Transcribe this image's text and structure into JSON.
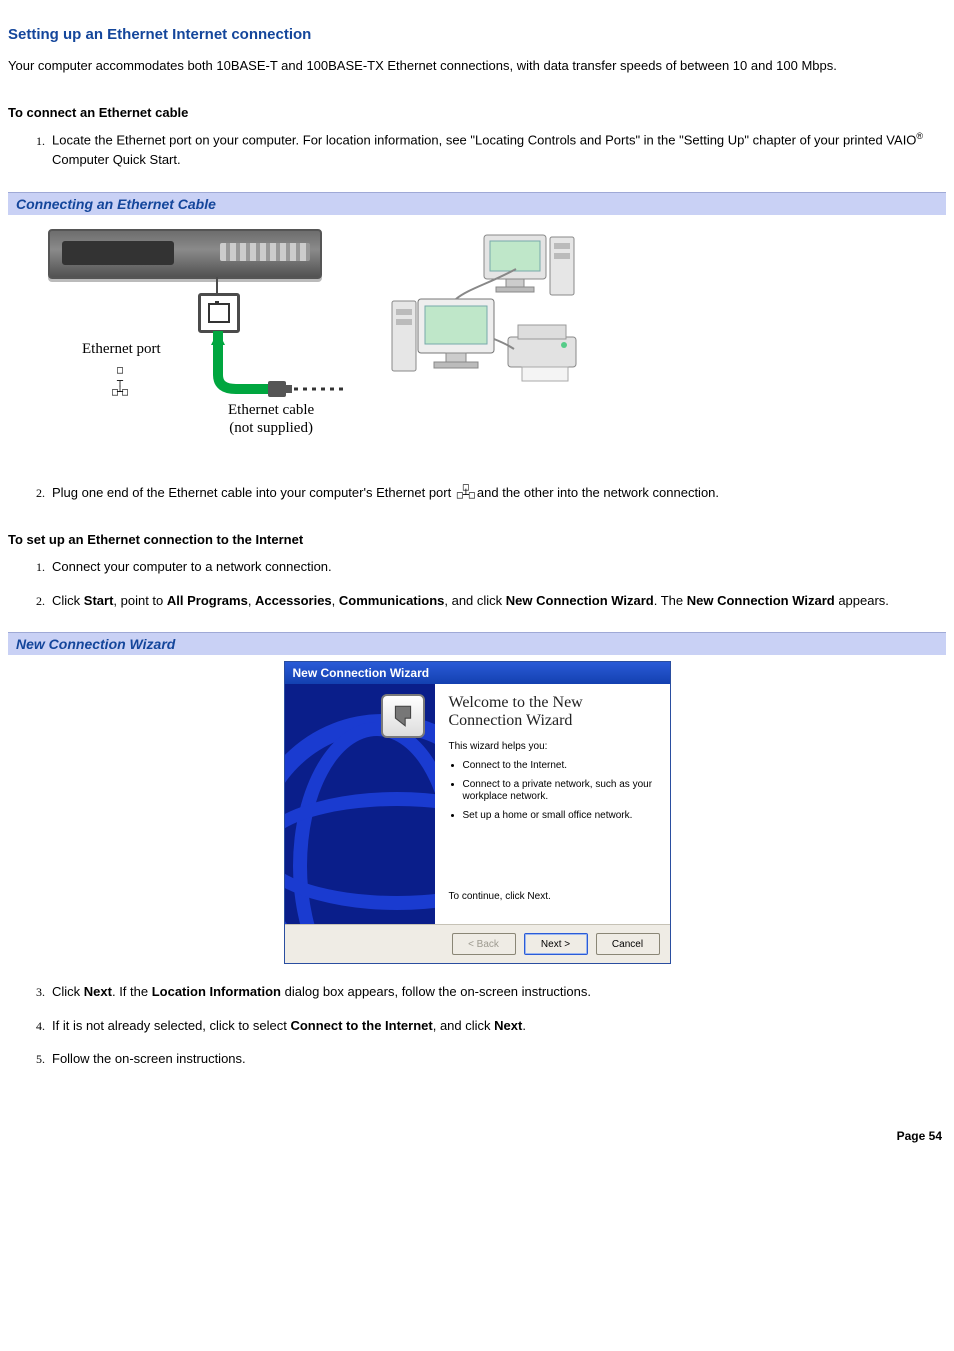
{
  "page": {
    "title": "Setting up an Ethernet Internet connection",
    "intro": "Your computer accommodates both 10BASE-T and 100BASE-TX Ethernet connections, with data transfer speeds of between 10 and 100 Mbps.",
    "page_number": "Page 54"
  },
  "section_connect_cable": {
    "heading": "To connect an Ethernet cable",
    "step1_a": "Locate the Ethernet port on your computer. For location information, see \"Locating Controls and Ports\" in the \"Setting Up\" chapter of your printed VAIO",
    "step1_b": " Computer Quick Start.",
    "reg": "®"
  },
  "figure_cable": {
    "title": "Connecting an Ethernet Cable",
    "port_label": "Ethernet port",
    "cable_caption_l1": "Ethernet cable",
    "cable_caption_l2": "(not supplied)"
  },
  "step_plug": {
    "a": "Plug one end of the Ethernet cable into your computer's Ethernet port ",
    "b": "and the other into the network connection."
  },
  "section_setup": {
    "heading": "To set up an Ethernet connection to the Internet",
    "step1": "Connect your computer to a network connection.",
    "step2": {
      "a": "Click ",
      "b_start": "Start",
      "c": ", point to ",
      "b_allprograms": "All Programs",
      "d": ", ",
      "b_accessories": "Accessories",
      "e": ", ",
      "b_comm": "Communications",
      "f": ", and click ",
      "b_wizard": "New Connection Wizard",
      "g": ". The ",
      "b_wizard2": "New Connection Wizard",
      "h": " appears."
    },
    "step3": {
      "a": "Click ",
      "b_next": "Next",
      "c": ". If the ",
      "b_loc": "Location Information",
      "d": " dialog box appears, follow the on-screen instructions."
    },
    "step4": {
      "a": "If it is not already selected, click to select ",
      "b_connect": "Connect to the Internet",
      "c": ", and click ",
      "b_next": "Next",
      "d": "."
    },
    "step5": "Follow the on-screen instructions."
  },
  "figure_wizard": {
    "title": "New Connection Wizard",
    "window_title": "New Connection Wizard",
    "heading": "Welcome to the New Connection Wizard",
    "helps": "This wizard helps you:",
    "bullets": [
      "Connect to the Internet.",
      "Connect to a private network, such as your workplace network.",
      "Set up a home or small office network."
    ],
    "continue": "To continue, click Next.",
    "buttons": {
      "back": "< Back",
      "next": "Next >",
      "cancel": "Cancel"
    }
  }
}
